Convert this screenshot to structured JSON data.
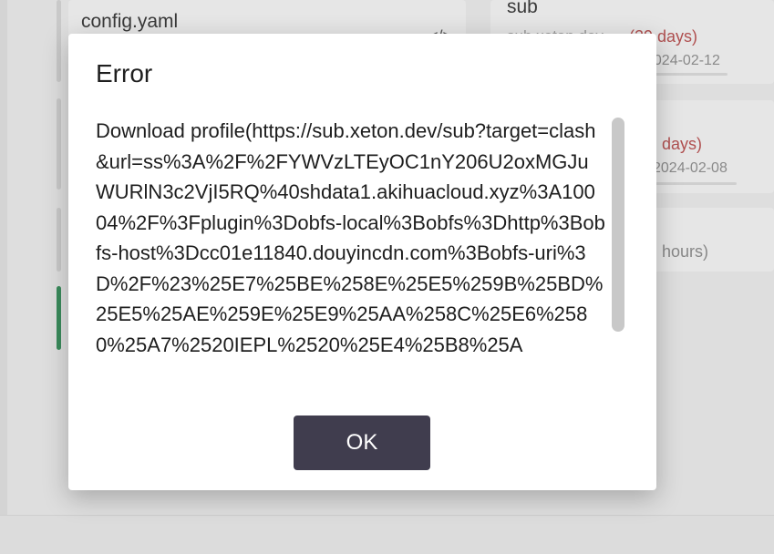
{
  "background": {
    "left_cards": [
      {
        "title": "config.yaml",
        "icon": "code-icon"
      }
    ],
    "right_cards": [
      {
        "title": "sub",
        "subtitle": "sub.xeton.dev",
        "remaining": "(29 days)",
        "date": "2024-02-12"
      },
      {
        "remaining": "days)",
        "date": "2024-02-08"
      },
      {
        "remaining": "hours)"
      }
    ]
  },
  "dialog": {
    "title": "Error",
    "message": "Download profile(https://sub.xeton.dev/sub?target=clash&url=ss%3A%2F%2FYWVzLTEyOC1nY206U2oxMGJuWURlN3c2VjI5RQ%40shdata1.akihuacloud.xyz%3A10004%2F%3Fplugin%3Dobfs-local%3Bobfs%3Dhttp%3Bobfs-host%3Dcc01e11840.douyincdn.com%3Bobfs-uri%3D%2F%23%25E7%25BE%258E%25E5%259B%25BD%25E5%25AE%259E%25E9%25AA%258C%25E6%2580%25A7%2520IEPL%2520%25E4%25B8%25A",
    "ok_label": "OK"
  },
  "colors": {
    "ok_button_bg": "#403d4e",
    "active_accent": "#3a8b5c",
    "warning_text": "#b05050"
  }
}
